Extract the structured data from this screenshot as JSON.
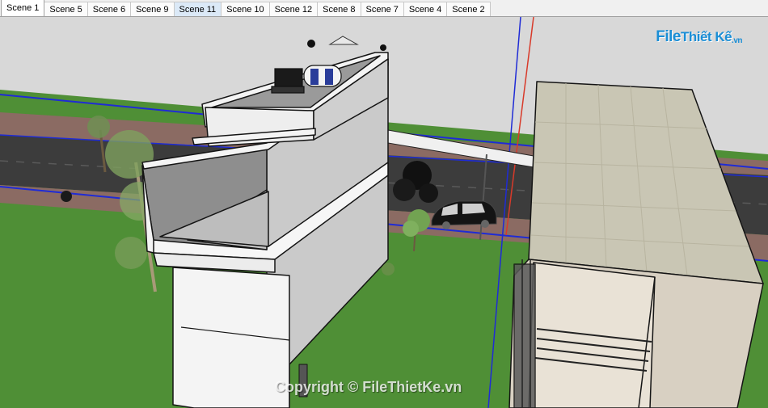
{
  "scene_tabs": [
    {
      "label": "Scene 1",
      "active": true
    },
    {
      "label": "Scene 5"
    },
    {
      "label": "Scene 6"
    },
    {
      "label": "Scene 9"
    },
    {
      "label": "Scene 11",
      "hover": true
    },
    {
      "label": "Scene 10"
    },
    {
      "label": "Scene 12"
    },
    {
      "label": "Scene 8"
    },
    {
      "label": "Scene 7"
    },
    {
      "label": "Scene 4"
    },
    {
      "label": "Scene 2"
    }
  ],
  "logo": {
    "part1": "File",
    "part2": "Thiết Kế",
    "part3": ".vn"
  },
  "watermark": "Copyright © FileThietKe.vn",
  "colors": {
    "sky": "#d6d6d6",
    "grass": "#4f8f36",
    "road": "#3a3a3a",
    "sidewalk": "#8a6a62",
    "wall": "#f4f4f4",
    "wall_shade": "#c9c9c9",
    "roof": "#c9c6b4",
    "axis_blue": "#1f2bd6",
    "axis_red": "#d83a2a"
  }
}
